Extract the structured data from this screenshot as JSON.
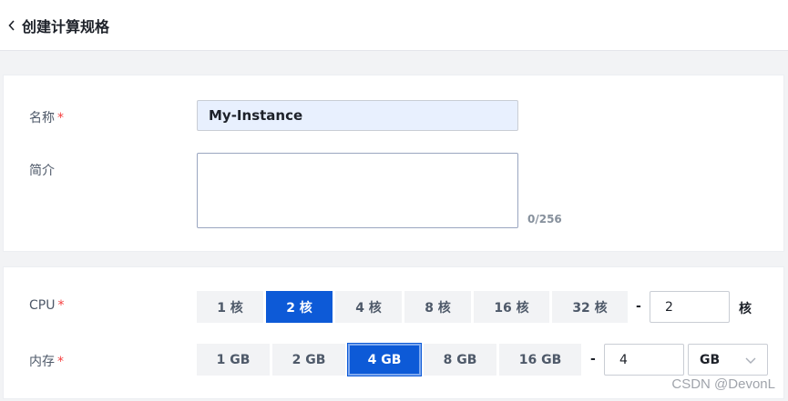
{
  "header": {
    "title": "创建计算规格",
    "back_icon": "chevron-left-icon"
  },
  "form": {
    "name": {
      "label": "名称",
      "required_mark": "*",
      "value": "My-Instance"
    },
    "description": {
      "label": "简介",
      "value": "",
      "counter": "0/256"
    }
  },
  "cpu": {
    "label": "CPU",
    "required_mark": "*",
    "options": [
      "1 核",
      "2 核",
      "4 核",
      "8 核",
      "16 核",
      "32 核"
    ],
    "selected_index": 1,
    "separator": "-",
    "custom_value": "2",
    "unit": "核"
  },
  "memory": {
    "label": "内存",
    "required_mark": "*",
    "options": [
      "1 GB",
      "2 GB",
      "4 GB",
      "8 GB",
      "16 GB"
    ],
    "selected_index": 2,
    "separator": "-",
    "custom_value": "4",
    "unit_select": "GB",
    "unit_select_icon": "chevron-down-icon"
  },
  "watermark": "CSDN @DevonL",
  "colors": {
    "primary": "#0d5ad7",
    "required": "#f53f3f",
    "input_autofill": "#e8f0fe"
  }
}
